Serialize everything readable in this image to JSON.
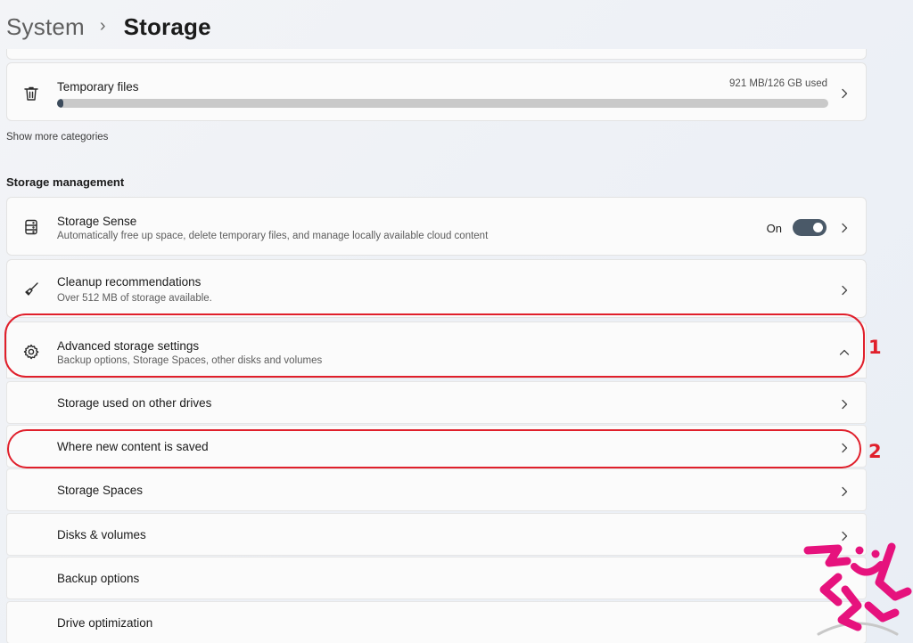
{
  "breadcrumb": {
    "parent": "System",
    "separator": "›",
    "current": "Storage"
  },
  "temporary_files": {
    "label": "Temporary files",
    "usage": "921 MB/126 GB used",
    "usage_fraction": 0.007,
    "icon": "trash-icon"
  },
  "show_more_link": "Show more categories",
  "storage_management": {
    "heading": "Storage management",
    "storage_sense": {
      "title": "Storage Sense",
      "subtitle": "Automatically free up space, delete temporary files, and manage locally available cloud content",
      "toggle_label": "On",
      "toggle_on": true,
      "icon": "drive-icon"
    },
    "cleanup": {
      "title": "Cleanup recommendations",
      "subtitle": "Over 512 MB of storage available.",
      "icon": "broom-icon"
    },
    "advanced": {
      "title": "Advanced storage settings",
      "subtitle": "Backup options, Storage Spaces, other disks and volumes",
      "expanded": true,
      "icon": "gear-icon",
      "items": [
        {
          "label": "Storage used on other drives",
          "has_chevron": true
        },
        {
          "label": "Where new content is saved",
          "has_chevron": true
        },
        {
          "label": "Storage Spaces",
          "has_chevron": true
        },
        {
          "label": "Disks & volumes",
          "has_chevron": true
        },
        {
          "label": "Backup options",
          "has_chevron": false
        },
        {
          "label": "Drive optimization",
          "has_chevron": false
        }
      ]
    }
  },
  "annotations": {
    "marker_1": "1",
    "marker_2": "2",
    "color": "#e01f2b"
  },
  "colors": {
    "accent_toggle": "#4a5968",
    "progress_fill": "#3c4b5c",
    "watermark": "#e6127d"
  }
}
